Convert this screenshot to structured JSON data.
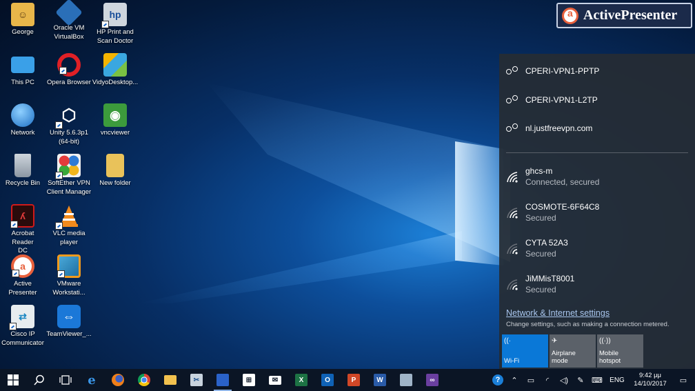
{
  "desktop": {
    "icons": [
      {
        "label": "George",
        "icon": "user-folder-icon"
      },
      {
        "label": "Oracle VM\nVirtualBox",
        "icon": "virtualbox-icon"
      },
      {
        "label": "HP Print and\nScan Doctor",
        "icon": "hp-icon"
      },
      {
        "label": "This PC",
        "icon": "computer-icon"
      },
      {
        "label": "Opera Browser",
        "icon": "opera-icon"
      },
      {
        "label": "VidyoDesktop...",
        "icon": "vidyo-icon"
      },
      {
        "label": "Network",
        "icon": "network-icon"
      },
      {
        "label": "Unity 5.6.3p1\n(64-bit)",
        "icon": "unity-icon"
      },
      {
        "label": "vncviewer",
        "icon": "vnc-icon"
      },
      {
        "label": "Recycle Bin",
        "icon": "recycle-bin-icon"
      },
      {
        "label": "SoftEther VPN\nClient Manager",
        "icon": "softether-icon"
      },
      {
        "label": "New folder",
        "icon": "folder-icon"
      },
      {
        "label": "Acrobat Reader\nDC",
        "icon": "acrobat-icon"
      },
      {
        "label": "VLC media\nplayer",
        "icon": "vlc-icon"
      },
      {
        "label": "Active\nPresenter",
        "icon": "activepresenter-icon"
      },
      {
        "label": "VMware\nWorkstati...",
        "icon": "vmware-icon"
      },
      {
        "label": "Cisco IP\nCommunicator",
        "icon": "cisco-icon"
      },
      {
        "label": "TeamViewer_...",
        "icon": "teamviewer-icon"
      }
    ]
  },
  "watermark": {
    "name": "ActivePresenter"
  },
  "flyout": {
    "vpns": [
      {
        "label": "CPERI-VPN1-PPTP"
      },
      {
        "label": "CPERI-VPN1-L2TP"
      },
      {
        "label": "nl.justfreevpn.com"
      }
    ],
    "networks": [
      {
        "name": "ghcs-m",
        "status": "Connected, secured"
      },
      {
        "name": "COSMOTE-6F64C8",
        "status": "Secured"
      },
      {
        "name": "CYTA 52A3",
        "status": "Secured"
      },
      {
        "name": "JiMMisT8001",
        "status": "Secured"
      }
    ],
    "settings_link": "Network & Internet settings",
    "settings_desc": "Change settings, such as making a connection metered.",
    "quick_actions": [
      {
        "label": "Wi-Fi",
        "active": true
      },
      {
        "label": "Airplane mode",
        "active": false
      },
      {
        "label": "Mobile\nhotspot",
        "active": false
      }
    ]
  },
  "taskbar": {
    "language": "ENG",
    "time": "9:42 μμ",
    "date": "14/10/2017"
  },
  "colors": {
    "accent": "#0a78d7",
    "tile_inactive": "#5b6169",
    "flyout_bg": "#262c34"
  }
}
